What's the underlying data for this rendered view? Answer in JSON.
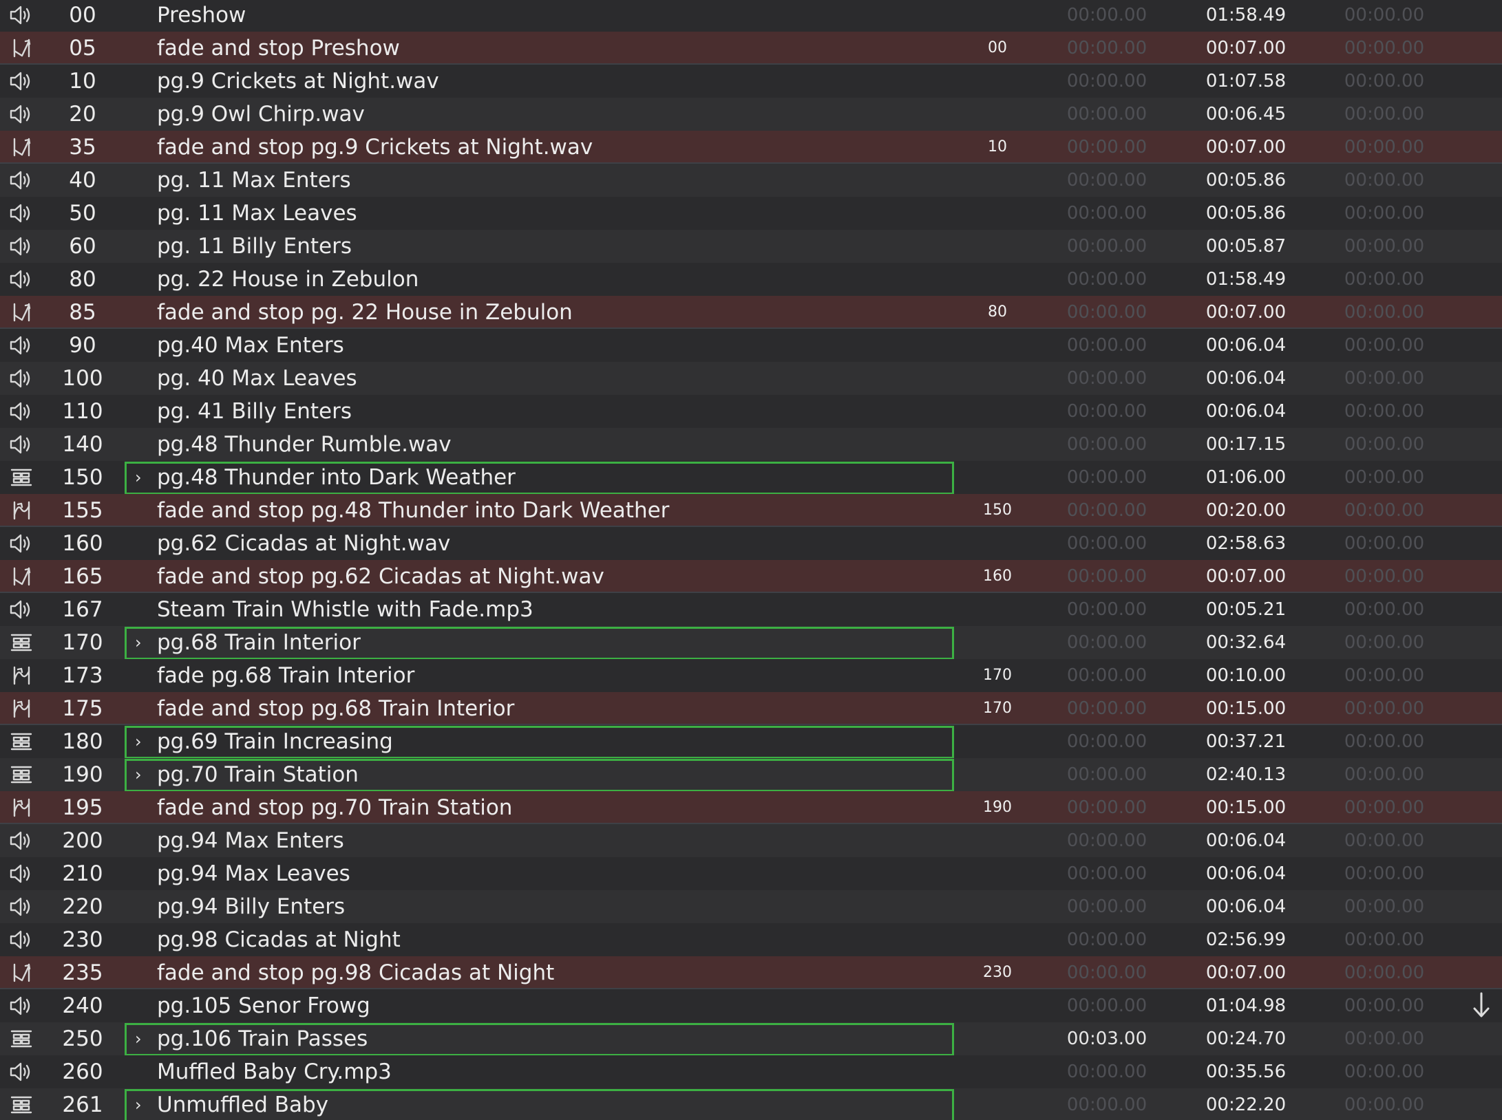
{
  "cues": [
    {
      "type": "audio",
      "number": "00",
      "name": "Preshow",
      "target": "",
      "pre_wait": "00:00.00",
      "action": "01:58.49",
      "post_wait": "00:00.00"
    },
    {
      "type": "fade-stop",
      "number": "05",
      "name": "fade and stop Preshow",
      "target": "00",
      "pre_wait": "00:00.00",
      "action": "00:07.00",
      "post_wait": "00:00.00"
    },
    {
      "type": "audio",
      "number": "10",
      "name": "pg.9 Crickets at Night.wav",
      "target": "",
      "pre_wait": "00:00.00",
      "action": "01:07.58",
      "post_wait": "00:00.00"
    },
    {
      "type": "audio",
      "number": "20",
      "name": "pg.9 Owl Chirp.wav",
      "target": "",
      "pre_wait": "00:00.00",
      "action": "00:06.45",
      "post_wait": "00:00.00"
    },
    {
      "type": "fade-stop",
      "number": "35",
      "name": "fade and stop pg.9 Crickets at Night.wav",
      "target": "10",
      "pre_wait": "00:00.00",
      "action": "00:07.00",
      "post_wait": "00:00.00"
    },
    {
      "type": "audio",
      "number": "40",
      "name": "pg. 11 Max Enters",
      "target": "",
      "pre_wait": "00:00.00",
      "action": "00:05.86",
      "post_wait": "00:00.00"
    },
    {
      "type": "audio",
      "number": "50",
      "name": "pg. 11 Max Leaves",
      "target": "",
      "pre_wait": "00:00.00",
      "action": "00:05.86",
      "post_wait": "00:00.00"
    },
    {
      "type": "audio",
      "number": "60",
      "name": "pg. 11 Billy Enters",
      "target": "",
      "pre_wait": "00:00.00",
      "action": "00:05.87",
      "post_wait": "00:00.00"
    },
    {
      "type": "audio",
      "number": "80",
      "name": "pg. 22 House in Zebulon",
      "target": "",
      "pre_wait": "00:00.00",
      "action": "01:58.49",
      "post_wait": "00:00.00"
    },
    {
      "type": "fade-stop",
      "number": "85",
      "name": "fade and stop pg. 22 House in Zebulon",
      "target": "80",
      "pre_wait": "00:00.00",
      "action": "00:07.00",
      "post_wait": "00:00.00"
    },
    {
      "type": "audio",
      "number": "90",
      "name": "pg.40 Max Enters",
      "target": "",
      "pre_wait": "00:00.00",
      "action": "00:06.04",
      "post_wait": "00:00.00"
    },
    {
      "type": "audio",
      "number": "100",
      "name": "pg. 40 Max Leaves",
      "target": "",
      "pre_wait": "00:00.00",
      "action": "00:06.04",
      "post_wait": "00:00.00"
    },
    {
      "type": "audio",
      "number": "110",
      "name": "pg. 41 Billy Enters",
      "target": "",
      "pre_wait": "00:00.00",
      "action": "00:06.04",
      "post_wait": "00:00.00"
    },
    {
      "type": "audio",
      "number": "140",
      "name": "pg.48 Thunder Rumble.wav",
      "target": "",
      "pre_wait": "00:00.00",
      "action": "00:17.15",
      "post_wait": "00:00.00"
    },
    {
      "type": "group",
      "number": "150",
      "name": "pg.48 Thunder into Dark Weather",
      "target": "",
      "pre_wait": "00:00.00",
      "action": "01:06.00",
      "post_wait": "00:00.00"
    },
    {
      "type": "fade-group",
      "number": "155",
      "name": "fade and stop pg.48 Thunder into Dark Weather",
      "target": "150",
      "pre_wait": "00:00.00",
      "action": "00:20.00",
      "post_wait": "00:00.00"
    },
    {
      "type": "audio",
      "number": "160",
      "name": "pg.62 Cicadas at Night.wav",
      "target": "",
      "pre_wait": "00:00.00",
      "action": "02:58.63",
      "post_wait": "00:00.00"
    },
    {
      "type": "fade-stop",
      "number": "165",
      "name": "fade and stop pg.62 Cicadas at Night.wav",
      "target": "160",
      "pre_wait": "00:00.00",
      "action": "00:07.00",
      "post_wait": "00:00.00"
    },
    {
      "type": "audio",
      "number": "167",
      "name": "Steam Train Whistle with Fade.mp3",
      "target": "",
      "pre_wait": "00:00.00",
      "action": "00:05.21",
      "post_wait": "00:00.00"
    },
    {
      "type": "group",
      "number": "170",
      "name": "pg.68 Train Interior",
      "target": "",
      "pre_wait": "00:00.00",
      "action": "00:32.64",
      "post_wait": "00:00.00"
    },
    {
      "type": "fade-group-plain",
      "number": "173",
      "name": "fade pg.68 Train Interior",
      "target": "170",
      "pre_wait": "00:00.00",
      "action": "00:10.00",
      "post_wait": "00:00.00"
    },
    {
      "type": "fade-group",
      "number": "175",
      "name": "fade and stop pg.68 Train Interior",
      "target": "170",
      "pre_wait": "00:00.00",
      "action": "00:15.00",
      "post_wait": "00:00.00"
    },
    {
      "type": "group",
      "number": "180",
      "name": "pg.69 Train Increasing",
      "target": "",
      "pre_wait": "00:00.00",
      "action": "00:37.21",
      "post_wait": "00:00.00"
    },
    {
      "type": "group",
      "number": "190",
      "name": "pg.70 Train Station",
      "target": "",
      "pre_wait": "00:00.00",
      "action": "02:40.13",
      "post_wait": "00:00.00"
    },
    {
      "type": "fade-group",
      "number": "195",
      "name": "fade and stop pg.70 Train Station",
      "target": "190",
      "pre_wait": "00:00.00",
      "action": "00:15.00",
      "post_wait": "00:00.00"
    },
    {
      "type": "audio",
      "number": "200",
      "name": "pg.94 Max Enters",
      "target": "",
      "pre_wait": "00:00.00",
      "action": "00:06.04",
      "post_wait": "00:00.00"
    },
    {
      "type": "audio",
      "number": "210",
      "name": "pg.94 Max Leaves",
      "target": "",
      "pre_wait": "00:00.00",
      "action": "00:06.04",
      "post_wait": "00:00.00"
    },
    {
      "type": "audio",
      "number": "220",
      "name": "pg.94 Billy Enters",
      "target": "",
      "pre_wait": "00:00.00",
      "action": "00:06.04",
      "post_wait": "00:00.00"
    },
    {
      "type": "audio",
      "number": "230",
      "name": "pg.98 Cicadas at Night",
      "target": "",
      "pre_wait": "00:00.00",
      "action": "02:56.99",
      "post_wait": "00:00.00"
    },
    {
      "type": "fade-stop",
      "number": "235",
      "name": "fade and stop pg.98 Cicadas at Night",
      "target": "230",
      "pre_wait": "00:00.00",
      "action": "00:07.00",
      "post_wait": "00:00.00"
    },
    {
      "type": "audio",
      "number": "240",
      "name": "pg.105 Senor Frowg",
      "target": "",
      "pre_wait": "00:00.00",
      "action": "01:04.98",
      "post_wait": "00:00.00"
    },
    {
      "type": "group",
      "number": "250",
      "name": "pg.106 Train Passes",
      "target": "",
      "pre_wait": "00:03.00",
      "action": "00:24.70",
      "post_wait": "00:00.00",
      "pre_wait_set": true
    },
    {
      "type": "audio",
      "number": "260",
      "name": "Muffled Baby Cry.mp3",
      "target": "",
      "pre_wait": "00:00.00",
      "action": "00:35.56",
      "post_wait": "00:00.00"
    },
    {
      "type": "group",
      "number": "261",
      "name": "Unmuffled Baby",
      "target": "",
      "pre_wait": "00:00.00",
      "action": "00:22.20",
      "post_wait": "00:00.00"
    }
  ],
  "scroll_indicator": {
    "icon": "arrow-down-icon"
  },
  "colors": {
    "background": "#2b2b2d",
    "row_alt": "#313133",
    "fade_row": "#4a2e2f",
    "group_outline": "#3cb043",
    "dim_time": "#4f5055"
  }
}
